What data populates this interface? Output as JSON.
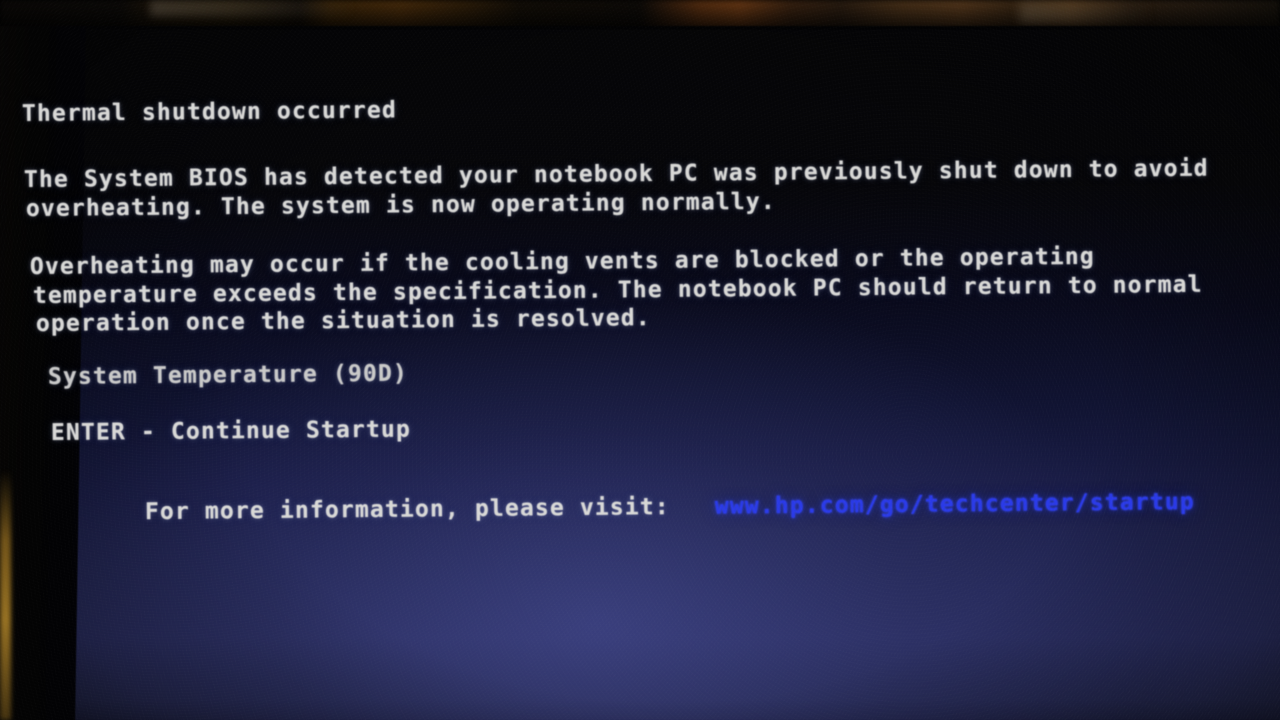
{
  "screen": {
    "kind": "bios-warning-screen",
    "vendor_hint": "HP",
    "background_colors": {
      "top": "#030305",
      "bottom": "#282c60",
      "bezel": "#020203"
    },
    "text_color": "#d8d8d6",
    "link_color": "#2a3ae8"
  },
  "message": {
    "title": "Thermal shutdown occurred",
    "paragraph_1": [
      "The System BIOS has detected your notebook PC was previously shut down to avoid",
      "overheating. The system is now operating normally."
    ],
    "paragraph_2": [
      "Overheating may occur if the cooling vents are blocked or the operating",
      "temperature exceeds the specification. The notebook PC should return to normal",
      "operation once the situation is resolved."
    ],
    "temperature_line": "System Temperature (90D)",
    "temperature_value": "90D",
    "key_prompt": "ENTER - Continue Startup",
    "key_name": "ENTER",
    "key_action": "Continue Startup",
    "info_prompt": "For more information, please visit:",
    "info_url": "www.hp.com/go/techcenter/startup"
  }
}
